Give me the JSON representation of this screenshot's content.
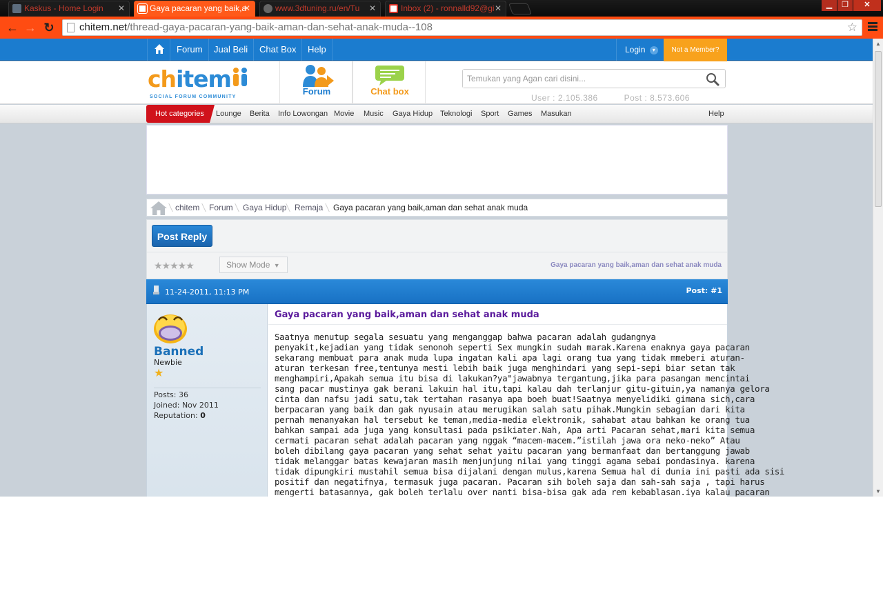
{
  "browser": {
    "tabs": [
      {
        "title": "Kaskus - Home Login",
        "favicon_color": "#5d6d7e"
      },
      {
        "title": "Gaya pacaran yang baik,aman",
        "favicon_color": "#ffffff"
      },
      {
        "title": "www.3dtuning.ru/en/Tu",
        "favicon_color": "#666666"
      },
      {
        "title": "Inbox (2) - ronnalld92@gi",
        "favicon_color": "#d93025"
      }
    ],
    "active_tab": 1,
    "url_host": "chitem.net",
    "url_path": "/thread-gaya-pacaran-yang-baik-aman-dan-sehat-anak-muda--108",
    "window_close": "✕",
    "window_min": "▁",
    "window_max": "❐"
  },
  "site": {
    "nav": {
      "items": [
        "Forum",
        "Jual Beli",
        "Chat Box",
        "Help"
      ],
      "login": "Login",
      "member": "Not a Member?"
    },
    "logo": {
      "word_a": "ch",
      "word_b": "item",
      "tagline": "SOCIAL FORUM COMMUNITY"
    },
    "hubs": {
      "forum": "Forum",
      "chat": "Chat box"
    },
    "search": {
      "placeholder": "Temukan yang Agan cari disini..."
    },
    "stats": {
      "users": "User : 2.105.386",
      "posts": "Post : 8.573.606"
    },
    "categories": {
      "hot": "Hot categories",
      "items": [
        "Lounge",
        "Berita",
        "Info Lowongan",
        "Movie",
        "Music",
        "Gaya Hidup",
        "Teknologi",
        "Sport",
        "Games",
        "Masukan"
      ],
      "help": "Help"
    },
    "breadcrumb": [
      "chitem",
      "Forum",
      "Gaya Hidup",
      "Remaja",
      "Gaya pacaran yang baik,aman dan sehat anak muda"
    ],
    "thread_tools": {
      "post_reply": "Post Reply",
      "rating": "★★★★★",
      "show_mode": "Show Mode",
      "title": "Gaya pacaran yang baik,aman dan sehat anak muda"
    },
    "post": {
      "date": "11-24-2011, 11:13 PM",
      "number": "Post: #1",
      "user": {
        "name": "Banned",
        "title": "Newbie",
        "posts": "Posts: 36",
        "joined": "Joined: Nov 2011",
        "reputation_label": "Reputation:",
        "reputation_value": "0"
      },
      "title": "Gaya pacaran yang baik,aman dan sehat anak muda",
      "lines": [
        "Saatnya menutup segala sesuatu yang menganggap bahwa pacaran adalah gudangnya",
        "penyakit,kejadian yang tidak senonoh seperti Sex mungkin sudah marak.Karena enaknya gaya pacaran",
        "sekarang membuat para anak muda lupa ingatan kali apa lagi orang tua yang tidak mmeberi aturan-",
        "aturan terkesan free,tentunya mesti lebih baik juga menghindari yang sepi-sepi biar setan tak",
        "menghampiri,Apakah semua itu bisa di lakukan?ya\"jawabnya tergantung,jika para pasangan mencintai",
        "sang pacar mustinya gak berani lakuin hal itu,tapi kalau dah terlanjur gitu-gituin,ya namanya gelora",
        "cinta dan nafsu jadi satu,tak tertahan rasanya apa boeh buat!Saatnya menyelidiki gimana sich,cara",
        "berpacaran yang baik dan gak nyusain atau merugikan salah satu pihak.Mungkin sebagian dari kita",
        "pernah menanyakan hal tersebut ke teman,media-media elektronik, sahabat atau bahkan ke orang tua",
        "bahkan sampai ada juga yang konsultasi pada psikiater.Nah, Apa arti Pacaran sehat,mari kita semua",
        "cermati pacaran sehat adalah pacaran yang nggak “macem-macem.”istilah jawa ora neko-neko” Atau",
        "boleh dibilang gaya pacaran yang sehat sehat yaitu pacaran yang bermanfaat dan bertanggung jawab",
        "tidak melanggar batas kewajaran masih menjunjung nilai yang tinggi agama sebai pondasinya. karena",
        "tidak dipungkiri mustahil semua bisa dijalani dengan mulus,karena Semua hal di dunia ini pasti ada sisi",
        "positif dan negatifnya, termasuk juga pacaran. Pacaran sih boleh saja dan sah-sah saja , tapi harus",
        "mengerti batasannya, gak boleh terlalu over nanti bisa-bisa gak ada rem kebablasan.iya kalau pacaran"
      ]
    }
  },
  "colors": {
    "accent_blue": "#1b7ccf",
    "accent_orange": "#f39a1b",
    "hot_red": "#d0121b",
    "chrome_orange": "#ff4c12"
  }
}
